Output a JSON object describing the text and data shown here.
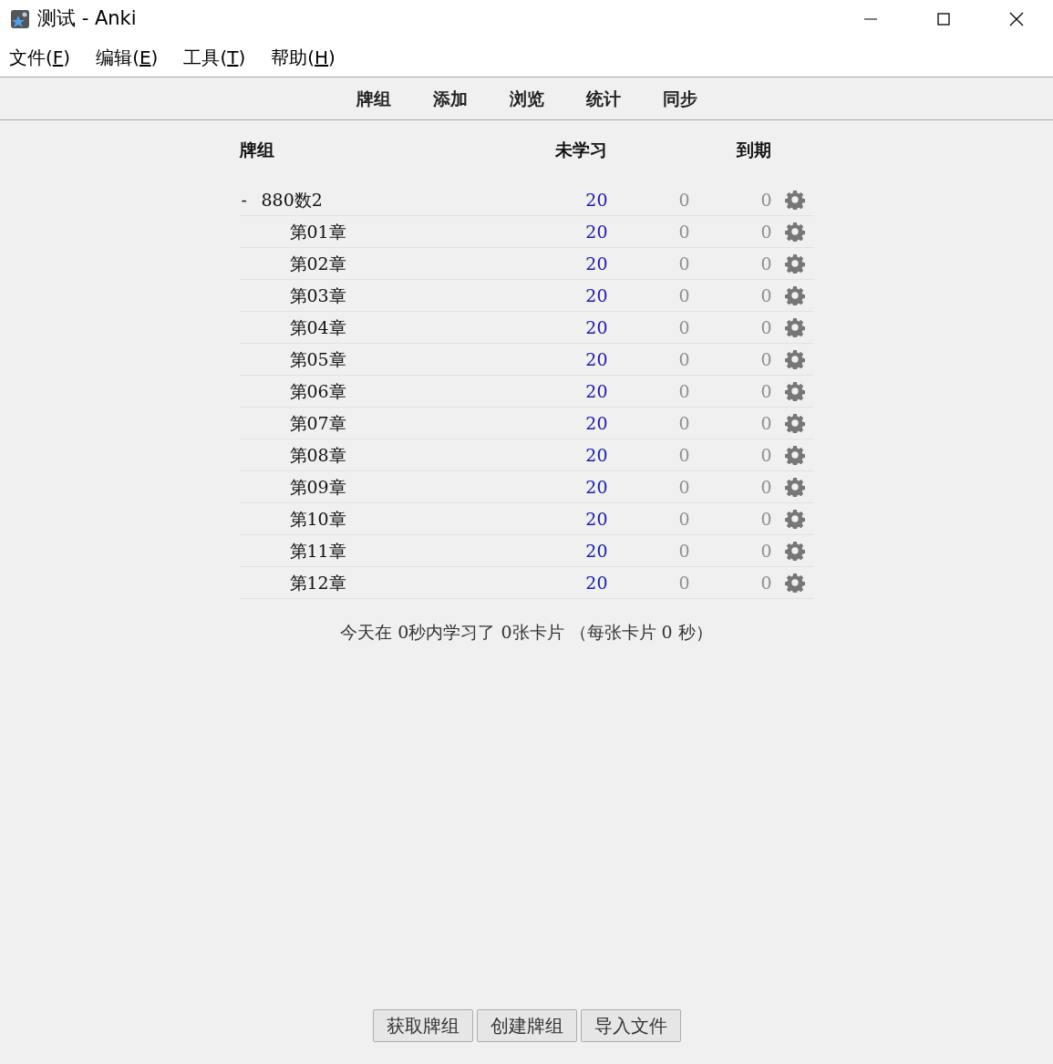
{
  "window": {
    "title": "测试 - Anki"
  },
  "menu": [
    {
      "label": "文件(",
      "mnemonic": "F",
      "suffix": ")"
    },
    {
      "label": "编辑(",
      "mnemonic": "E",
      "suffix": ")"
    },
    {
      "label": "工具(",
      "mnemonic": "T",
      "suffix": ")"
    },
    {
      "label": "帮助(",
      "mnemonic": "H",
      "suffix": ")"
    }
  ],
  "toolbar": [
    "牌组",
    "添加",
    "浏览",
    "统计",
    "同步"
  ],
  "table": {
    "columns": [
      "牌组",
      "未学习",
      "到期"
    ],
    "rows": [
      {
        "name": "880数2",
        "expander": "-",
        "expanded": true,
        "counts": [
          "20",
          "0",
          "0"
        ],
        "children": [
          {
            "name": "第01章",
            "counts": [
              "20",
              "0",
              "0"
            ]
          },
          {
            "name": "第02章",
            "counts": [
              "20",
              "0",
              "0"
            ]
          },
          {
            "name": "第03章",
            "counts": [
              "20",
              "0",
              "0"
            ]
          },
          {
            "name": "第04章",
            "counts": [
              "20",
              "0",
              "0"
            ]
          },
          {
            "name": "第05章",
            "counts": [
              "20",
              "0",
              "0"
            ]
          },
          {
            "name": "第06章",
            "counts": [
              "20",
              "0",
              "0"
            ]
          },
          {
            "name": "第07章",
            "counts": [
              "20",
              "0",
              "0"
            ]
          },
          {
            "name": "第08章",
            "counts": [
              "20",
              "0",
              "0"
            ]
          },
          {
            "name": "第09章",
            "counts": [
              "20",
              "0",
              "0"
            ]
          },
          {
            "name": "第10章",
            "counts": [
              "20",
              "0",
              "0"
            ]
          },
          {
            "name": "第11章",
            "counts": [
              "20",
              "0",
              "0"
            ]
          },
          {
            "name": "第12章",
            "counts": [
              "20",
              "0",
              "0"
            ]
          }
        ]
      }
    ]
  },
  "summary": "今天在 0秒内学习了 0张卡片 （每张卡片 0 秒）",
  "buttons": [
    "获取牌组",
    "创建牌组",
    "导入文件"
  ]
}
